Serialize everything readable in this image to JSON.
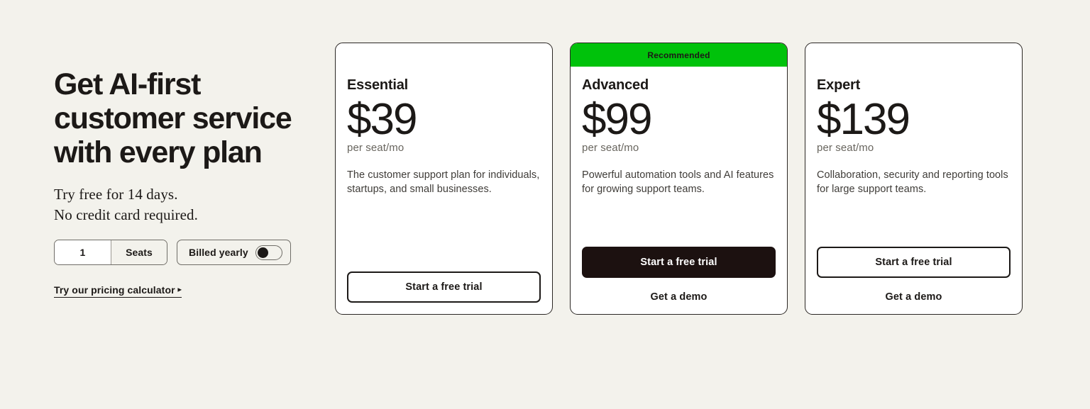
{
  "theme": {
    "page_background": "#f3f2ec",
    "text_color": "#1c1917",
    "muted_text_color": "#68655e",
    "recommended_badge_color": "#00c20b",
    "solid_button_color": "#1c1110",
    "card_background": "#ffffff"
  },
  "hero": {
    "headline": "Get AI-first\ncustomer service\nwith every plan",
    "subhead": "Try free for 14 days.\nNo credit card required.",
    "seats": {
      "value": "1",
      "placeholder": "1",
      "label": "Seats"
    },
    "billing": {
      "label": "Billed yearly",
      "toggle_state": "on",
      "knob_position": "left"
    },
    "calculator_link": {
      "label": "Try our pricing calculator",
      "arrow_glyph": "▸"
    }
  },
  "plans": [
    {
      "name": "Essential",
      "price": "$39",
      "price_unit": "per seat/mo",
      "description": "The customer support plan for individuals, startups, and small businesses.",
      "ribbon": "",
      "primary_cta": "Start a free trial",
      "primary_cta_style": "outline",
      "secondary_cta": ""
    },
    {
      "name": "Advanced",
      "price": "$99",
      "price_unit": "per seat/mo",
      "description": "Powerful automation tools and AI features for growing support teams.",
      "ribbon": "Recommended",
      "primary_cta": "Start a free trial",
      "primary_cta_style": "solid",
      "secondary_cta": "Get a demo"
    },
    {
      "name": "Expert",
      "price": "$139",
      "price_unit": "per seat/mo",
      "description": "Collaboration, security and reporting tools for large support teams.",
      "ribbon": "",
      "primary_cta": "Start a free trial",
      "primary_cta_style": "outline",
      "secondary_cta": "Get a demo"
    }
  ]
}
